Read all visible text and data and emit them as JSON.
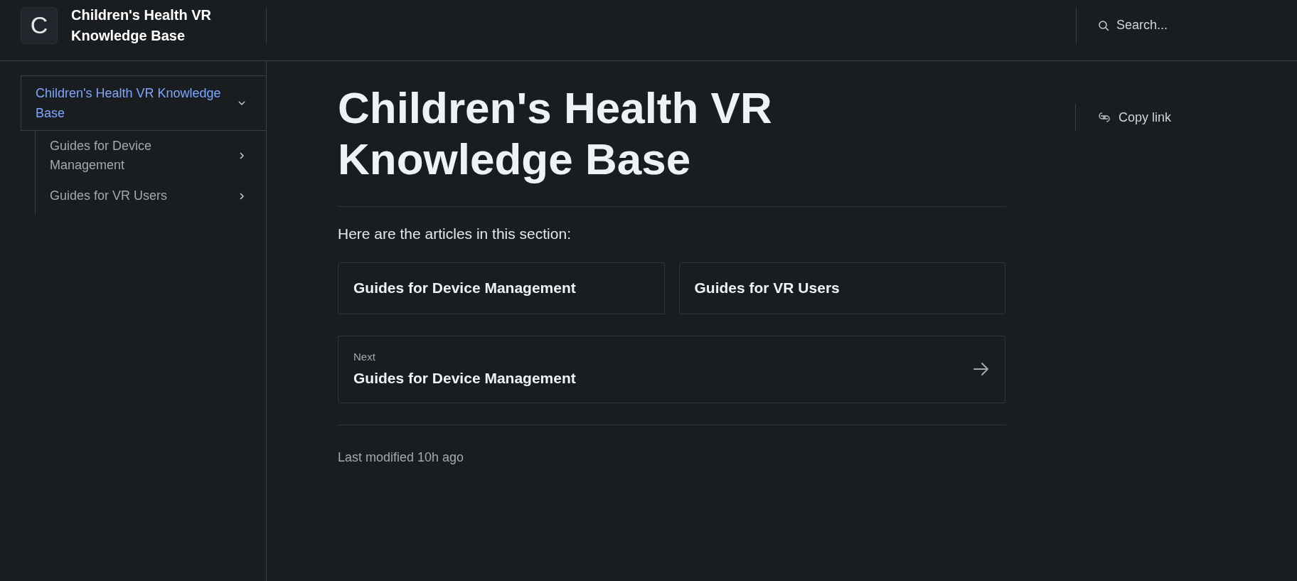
{
  "header": {
    "logo_letter": "C",
    "title": "Children's Health VR Knowledge Base",
    "search": {
      "placeholder": "Search..."
    }
  },
  "sidebar": {
    "items": [
      {
        "label": "Children's Health VR Knowledge Base",
        "selected": true,
        "expanded": true,
        "children": [
          {
            "label": "Guides for Device Management",
            "selected": false,
            "expanded": false
          },
          {
            "label": "Guides for VR Users",
            "selected": false,
            "expanded": false
          }
        ]
      }
    ]
  },
  "article": {
    "title": "Children's Health VR Knowledge Base",
    "intro": "Here are the articles in this section:",
    "cards": [
      {
        "title": "Guides for Device Management"
      },
      {
        "title": "Guides for VR Users"
      }
    ],
    "next": {
      "label": "Next",
      "title": "Guides for Device Management"
    },
    "last_modified": "Last modified 10h ago"
  },
  "toc": {
    "copy_link": "Copy link"
  }
}
